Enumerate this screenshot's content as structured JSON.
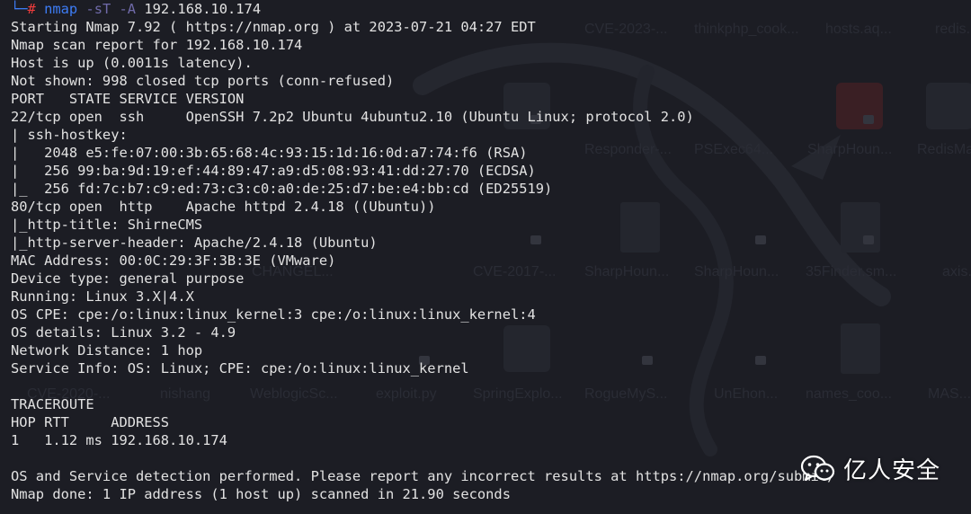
{
  "terminal": {
    "command": {
      "prompt_corner": "└─",
      "prompt_symbol": "#",
      "program": "nmap",
      "flags": "-sT -A",
      "target": "192.168.10.174"
    },
    "lines": [
      "Starting Nmap 7.92 ( https://nmap.org ) at 2023-07-21 04:27 EDT",
      "Nmap scan report for 192.168.10.174",
      "Host is up (0.0011s latency).",
      "Not shown: 998 closed tcp ports (conn-refused)",
      "PORT   STATE SERVICE VERSION",
      "22/tcp open  ssh     OpenSSH 7.2p2 Ubuntu 4ubuntu2.10 (Ubuntu Linux; protocol 2.0)",
      "| ssh-hostkey: ",
      "|   2048 e5:fe:07:00:3b:65:68:4c:93:15:1d:16:0d:a7:74:f6 (RSA)",
      "|   256 99:ba:9d:19:ef:44:89:47:a9:d5:08:93:41:dd:27:70 (ECDSA)",
      "|_  256 fd:7c:b7:c9:ed:73:c3:c0:a0:de:25:d7:be:e4:bb:cd (ED25519)",
      "80/tcp open  http    Apache httpd 2.4.18 ((Ubuntu))",
      "|_http-title: ShirneCMS",
      "|_http-server-header: Apache/2.4.18 (Ubuntu)",
      "MAC Address: 00:0C:29:3F:3B:3E (VMware)",
      "Device type: general purpose",
      "Running: Linux 3.X|4.X",
      "OS CPE: cpe:/o:linux:linux_kernel:3 cpe:/o:linux:linux_kernel:4",
      "OS details: Linux 3.2 - 4.9",
      "Network Distance: 1 hop",
      "Service Info: OS: Linux; CPE: cpe:/o:linux:linux_kernel",
      "",
      "TRACEROUTE",
      "HOP RTT     ADDRESS",
      "1   1.12 ms 192.168.10.174",
      "",
      "OS and Service detection performed. Please report any incorrect results at https://nmap.org/submit/ .",
      "Nmap done: 1 IP address (1 host up) scanned in 21.90 seconds"
    ]
  },
  "desktop": {
    "labels_row1": [
      "CVE-2023-...",
      "thinkphp_cook...",
      "hosts.aq...",
      "redis..."
    ],
    "labels_row2": [
      "Responder-...",
      "PSExec64...",
      "SharpHoun...",
      "RedisMan..."
    ],
    "labels_row3": [
      "CHANGEL...",
      "CVE-2017-...",
      "SharpHoun...",
      "SharpHoun...",
      "35Finder.sm...",
      "axis..."
    ],
    "labels_row4": [
      "CVE-2020-...",
      "nishang",
      "WeblogicSc...",
      "exploit.py",
      "SpringExplo...",
      "RogueMyS...",
      "UnEhon...",
      "names_coo...",
      "MAS..."
    ]
  },
  "watermark": {
    "label": "亿人安全",
    "icon": "wechat-icon"
  },
  "colors": {
    "background": "#1c1d24",
    "text": "#e2e2e2",
    "prompt_blue": "#3d7cf5",
    "prompt_red": "#ee3c3c",
    "flags_purple": "#6f6aa8"
  }
}
